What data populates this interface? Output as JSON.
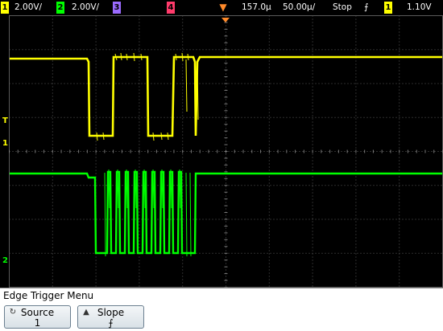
{
  "status_bar": {
    "ch1": {
      "number": "1",
      "scale": "2.00V/",
      "color": "#ffff00"
    },
    "ch2": {
      "number": "2",
      "scale": "2.00V/",
      "color": "#00ff00"
    },
    "ch3": {
      "number": "3",
      "color": "#9b6bff"
    },
    "ch4": {
      "number": "4",
      "color": "#ff3b6b"
    },
    "trigger_time": "157.0µ",
    "timebase": "50.00µ/",
    "run_state": "Stop",
    "slope_icon": "⨍",
    "trigger_source": "1",
    "trigger_level": "1.10V"
  },
  "markers": {
    "trigger_level": "T",
    "ch1_ground": "1",
    "ch2_ground": "2"
  },
  "menu": {
    "title": "Edge Trigger Menu",
    "softkeys": [
      {
        "label": "Source",
        "value": "1",
        "knob_icon": "rotate-knob-icon"
      },
      {
        "label": "Slope",
        "value": "⨍",
        "knob_icon": "up-arrow-icon"
      }
    ]
  },
  "colors": {
    "ch1": "#ffff00",
    "ch2": "#00ff00",
    "grid": "#5a5a5a",
    "trigger_marker": "#ff8a2a"
  }
}
